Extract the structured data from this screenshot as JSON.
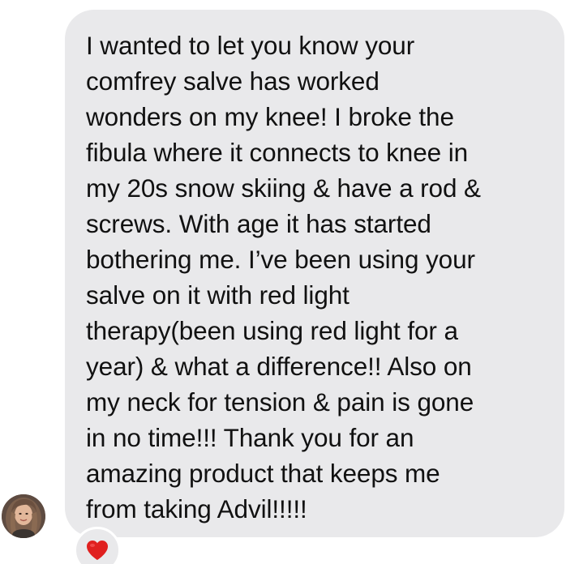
{
  "message": {
    "text": "I wanted to let you know your\ncomfrey salve has worked\nwonders on my knee! I broke the\nfibula where it connects to knee in\nmy 20s snow skiing & have a rod &\nscrews. With age it has started\nbothering me. I’ve been using your\nsalve on it with red light\ntherapy(been using red light for a\nyear) & what a difference!! Also on\nmy neck for tension & pain is gone\nin no time!!! Thank you for an\namazing product that keeps me\nfrom taking Advil!!!!!"
  },
  "reaction": {
    "icon": "heart-icon",
    "color": "#e0201f"
  },
  "sender": {
    "avatar_icon": "avatar"
  },
  "colors": {
    "bubble_background": "#e9e9eb",
    "text": "#111111",
    "page_background": "#ffffff"
  }
}
